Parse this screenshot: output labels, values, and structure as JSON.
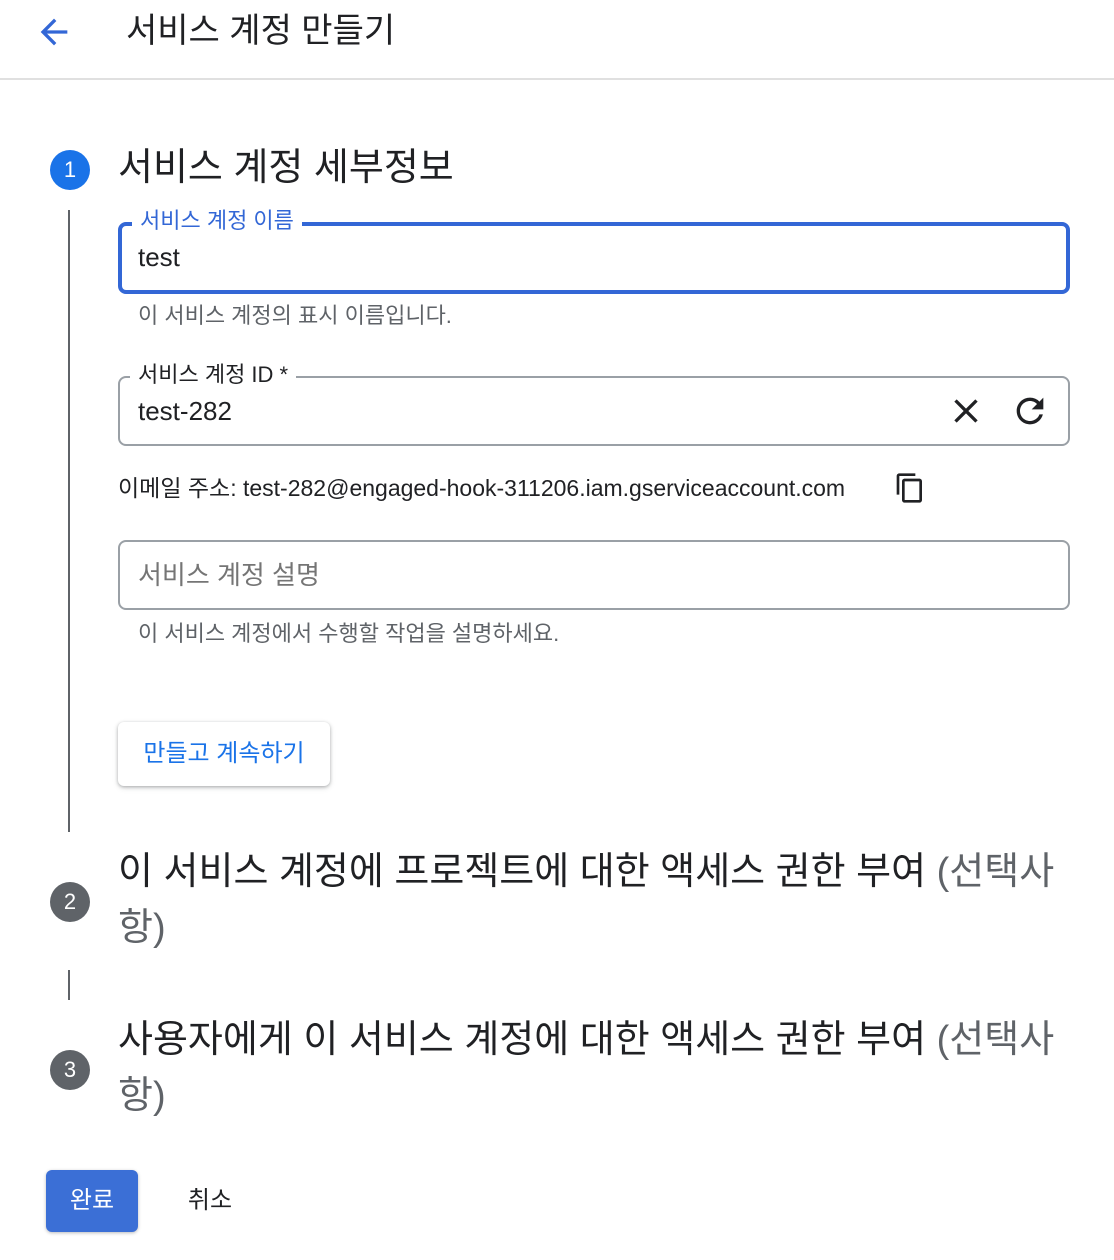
{
  "header": {
    "title": "서비스 계정 만들기",
    "back_icon": "arrow-left-icon"
  },
  "colors": {
    "accent": "#1a73e8",
    "focus_border": "#3367d6",
    "step_inactive": "#5f6368",
    "primary_button": "#3b6fd6"
  },
  "steps": [
    {
      "number": "1",
      "title": "서비스 계정 세부정보",
      "state": "active"
    },
    {
      "number": "2",
      "title": "이 서비스 계정에 프로젝트에 대한 액세스 권한 부여",
      "optional": "(선택사항)",
      "state": "inactive"
    },
    {
      "number": "3",
      "title": "사용자에게 이 서비스 계정에 대한 액세스 권한 부여",
      "optional": "(선택사항)",
      "state": "inactive"
    }
  ],
  "form": {
    "name_field": {
      "label": "서비스 계정 이름",
      "value": "test",
      "hint": "이 서비스 계정의 표시 이름입니다."
    },
    "id_field": {
      "label": "서비스 계정 ID *",
      "value": "test-282",
      "clear_icon": "close-icon",
      "refresh_icon": "refresh-icon"
    },
    "email": {
      "label": "이메일 주소:",
      "value": "test-282@engaged-hook-311206.iam.gserviceaccount.com",
      "copy_icon": "copy-icon"
    },
    "description_field": {
      "placeholder": "서비스 계정 설명",
      "hint": "이 서비스 계정에서 수행할 작업을 설명하세요."
    },
    "create_continue_label": "만들고 계속하기"
  },
  "footer": {
    "done_label": "완료",
    "cancel_label": "취소"
  }
}
